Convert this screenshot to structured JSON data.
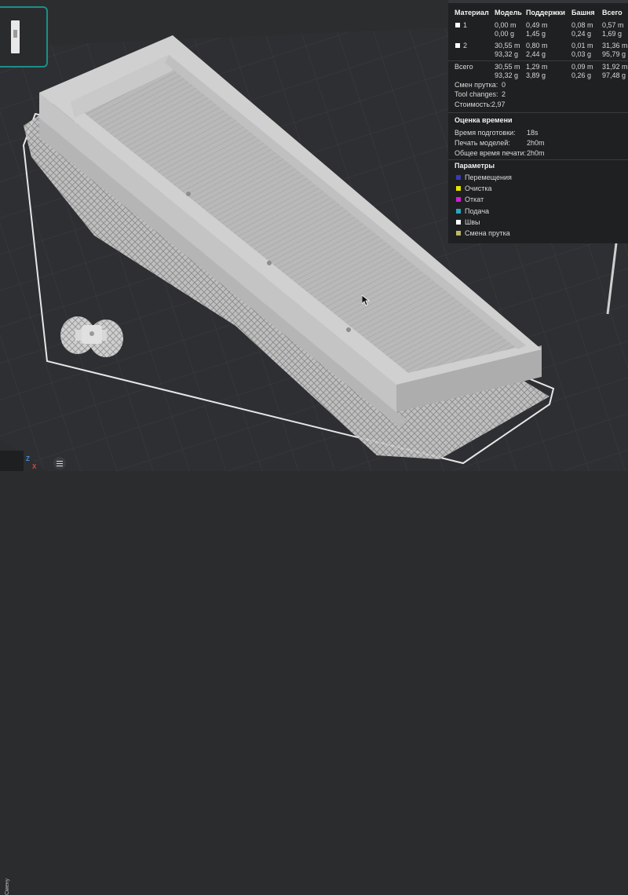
{
  "stats": {
    "headers": [
      "Материал",
      "Модель",
      "Поддержки",
      "Башня",
      "Всего"
    ],
    "rows": [
      {
        "label": "1",
        "model_m": "0,00 m",
        "model_g": "0,00 g",
        "sup_m": "0,49 m",
        "sup_g": "1,45 g",
        "tower_m": "0,08 m",
        "tower_g": "0,24 g",
        "total_m": "0,57 m",
        "total_g": "1,69 g",
        "color": "#ffffff"
      },
      {
        "label": "2",
        "model_m": "30,55 m",
        "model_g": "93,32 g",
        "sup_m": "0,80 m",
        "sup_g": "2,44 g",
        "tower_m": "0,01 m",
        "tower_g": "0,03 g",
        "total_m": "31,36 m",
        "total_g": "95,79 g",
        "color": "#ffffff"
      }
    ],
    "total": {
      "label": "Всего",
      "model_m": "30,55 m",
      "model_g": "93,32 g",
      "sup_m": "1,29 m",
      "sup_g": "3,89 g",
      "tower_m": "0,09 m",
      "tower_g": "0,26 g",
      "total_m": "31,92 m",
      "total_g": "97,48 g"
    },
    "filament_changes_label": "Смен прутка:",
    "filament_changes_value": "0",
    "tool_changes_label": "Tool changes:",
    "tool_changes_value": "2",
    "cost_label": "Стоимость:",
    "cost_value": "2,97"
  },
  "time": {
    "title": "Оценка времени",
    "prep_label": "Время подготовки:",
    "prep_value": "18s",
    "print_label": "Печать моделей:",
    "print_value": "2h0m",
    "total_label": "Общее время печати:",
    "total_value": "2h0m"
  },
  "params": {
    "title": "Параметры",
    "items": [
      {
        "label": "Перемещения",
        "color": "#3a3ab0"
      },
      {
        "label": "Очистка",
        "color": "#e6e600"
      },
      {
        "label": "Откат",
        "color": "#d41cd4"
      },
      {
        "label": "Подача",
        "color": "#2aa6c0"
      },
      {
        "label": "Швы",
        "color": "#ffffff"
      },
      {
        "label": "Смена прутка",
        "color": "#bcb66a"
      }
    ]
  },
  "bottom": {
    "axis_z": "Z",
    "axis_x": "X",
    "side_label": "Смену"
  },
  "colors": {
    "accent": "#1d8e8a",
    "bed": "#2f3033",
    "model": "#bdbdbd"
  }
}
